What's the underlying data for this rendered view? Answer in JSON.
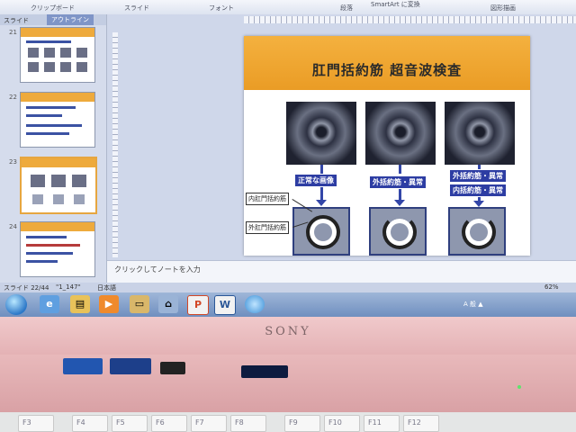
{
  "ribbon": {
    "clipboard": "クリップボード",
    "slide": "スライド",
    "font": "フォント",
    "paragraph": "段落",
    "smartart": "SmartArt に変換",
    "shapes": "図形描画"
  },
  "left_panel": {
    "tab_slides": "スライド",
    "tab_outline": "アウトライン",
    "thumb_numbers": [
      "21",
      "22",
      "23",
      "24"
    ]
  },
  "slide": {
    "title": "肛門括約筋 超音波検査",
    "labels": {
      "normal": "正常な画像",
      "external_abnormal": "外括約筋・異常",
      "external_abnormal_2": "外括約筋・異常",
      "internal_abnormal": "内括約筋・異常"
    },
    "callouts": {
      "internal": "内肛門括約筋",
      "external": "外肛門括約筋"
    }
  },
  "notes": {
    "placeholder": "クリックしてノートを入力"
  },
  "statusbar": {
    "slide_info": "スライド 22/44",
    "theme": "\"1_147\"",
    "language": "日本語",
    "zoom": "62%"
  },
  "taskbar": {
    "apps": [
      "ie-icon",
      "explorer-icon",
      "media-icon",
      "folder-icon",
      "network-icon",
      "powerpoint-icon",
      "word-icon",
      "globe-icon"
    ],
    "tray_text": "A 般 ▲"
  },
  "laptop": {
    "brand": "SONY",
    "keys": [
      "F3",
      "F4",
      "F5",
      "F6",
      "F7",
      "F8",
      "F9",
      "F10",
      "F11",
      "F12"
    ]
  },
  "colors": {
    "slide_orange": "#ea9c25",
    "label_blue": "#2d3da3"
  }
}
